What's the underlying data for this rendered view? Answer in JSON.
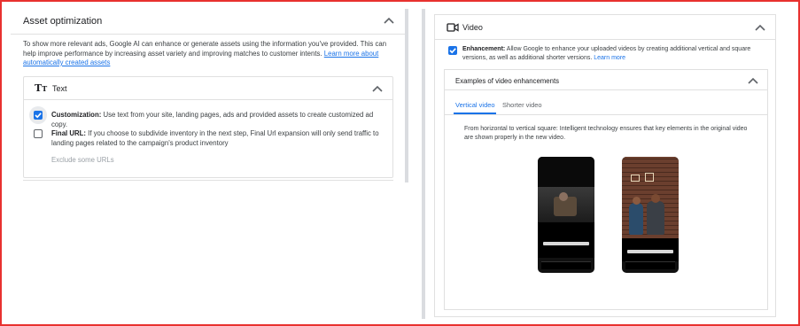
{
  "left": {
    "title": "Asset optimization",
    "description": "To show more relevant ads, Google AI can enhance or generate assets using the information you've provided. This can help improve performance by increasing asset variety and improving matches to customer intents.",
    "learn_more": "Learn more about automatically created assets",
    "text_section": {
      "title": "Text",
      "customization_label": "Customization:",
      "customization_text": "Use text from your site, landing pages, ads and provided assets to create customized ad copy.",
      "customization_checked": true,
      "final_url_label": "Final URL:",
      "final_url_text": "If you choose to subdivide inventory in the next step, Final Url expansion will only send traffic to landing pages related to the campaign's product inventory",
      "final_url_checked": false,
      "exclude_label": "Exclude some URLs"
    }
  },
  "right": {
    "title": "Video",
    "enhancement_label": "Enhancement:",
    "enhancement_text": "Allow Google to enhance your uploaded videos by creating additional vertical and square versions, as well as additional shorter versions.",
    "enhancement_link": "Learn more",
    "enhancement_checked": true,
    "examples_title": "Examples of video enhancements",
    "tabs": [
      {
        "label": "Vertical video",
        "active": true
      },
      {
        "label": "Shorter video",
        "active": false
      }
    ],
    "example_description": "From horizontal to vertical square: Intelligent technology ensures that key elements in the original video are shown properly in the new video."
  },
  "colors": {
    "accent": "#1a73e8",
    "border_highlight": "#e8312f"
  }
}
